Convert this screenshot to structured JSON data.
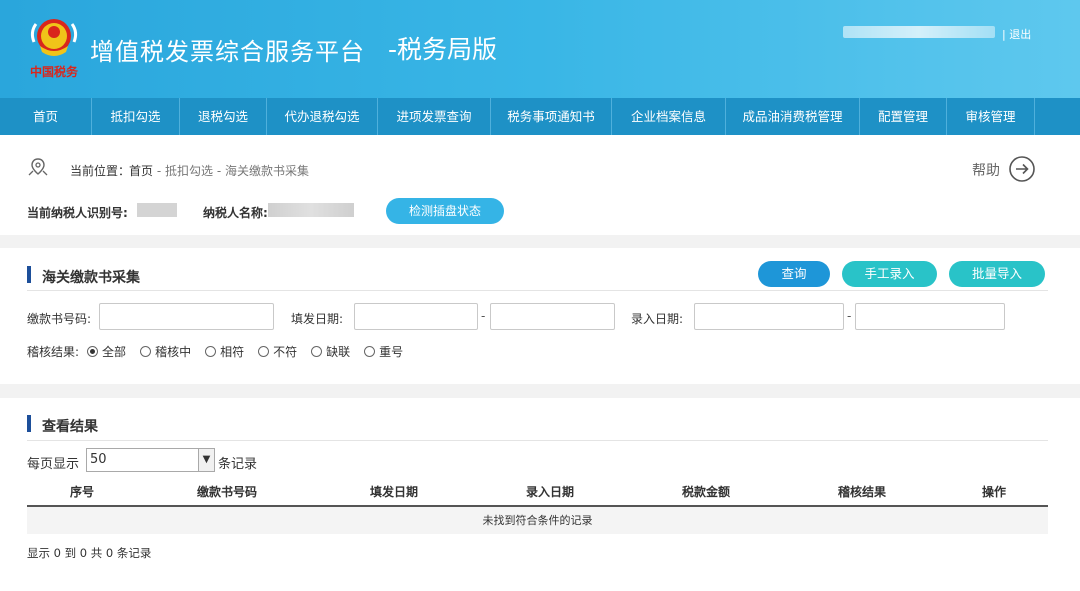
{
  "header": {
    "title": "增值税发票综合服务平台",
    "subtitle": "-税务局版",
    "logo_text": "中国税务",
    "logout": "| 退出"
  },
  "nav": {
    "items": [
      {
        "label": "首页"
      },
      {
        "label": "抵扣勾选"
      },
      {
        "label": "退税勾选"
      },
      {
        "label": "代办退税勾选"
      },
      {
        "label": "进项发票查询"
      },
      {
        "label": "税务事项通知书"
      },
      {
        "label": "企业档案信息"
      },
      {
        "label": "成品油消费税管理"
      },
      {
        "label": "配置管理"
      },
      {
        "label": "审核管理"
      }
    ]
  },
  "location": {
    "label": "当前位置：",
    "home": "首页",
    "sep": " - ",
    "level1": "抵扣勾选",
    "level2": "海关缴款书采集",
    "help": "帮助"
  },
  "taxpayer": {
    "id_label": "当前纳税人识别号:",
    "name_label": "纳税人名称:",
    "detect_button": "检测插盘状态"
  },
  "search": {
    "title": "海关缴款书采集",
    "query_button": "查询",
    "manual_button": "手工录入",
    "batch_button": "批量导入",
    "code_label": "缴款书号码:",
    "issue_date_label": "填发日期:",
    "entry_date_label": "录入日期:",
    "dash": "-",
    "audit_label": "稽核结果:",
    "audit_options": [
      {
        "label": "全部",
        "checked": true
      },
      {
        "label": "稽核中",
        "checked": false
      },
      {
        "label": "相符",
        "checked": false
      },
      {
        "label": "不符",
        "checked": false
      },
      {
        "label": "缺联",
        "checked": false
      },
      {
        "label": "重号",
        "checked": false
      }
    ]
  },
  "results": {
    "title": "查看结果",
    "per_page_label": "每页显示",
    "per_page_value": "50",
    "records_label": "条记录",
    "columns": [
      "序号",
      "缴款书号码",
      "填发日期",
      "录入日期",
      "税款金额",
      "稽核结果",
      "操作"
    ],
    "empty_text": "未找到符合条件的记录",
    "footer": "显示 0 到 0 共 0 条记录"
  },
  "colors": {
    "header": "#39b6e6",
    "nav": "#1e91c6",
    "accent_blue": "#1e96d8",
    "accent_teal": "#29c3c8",
    "section_bar": "#1d4f9a"
  }
}
